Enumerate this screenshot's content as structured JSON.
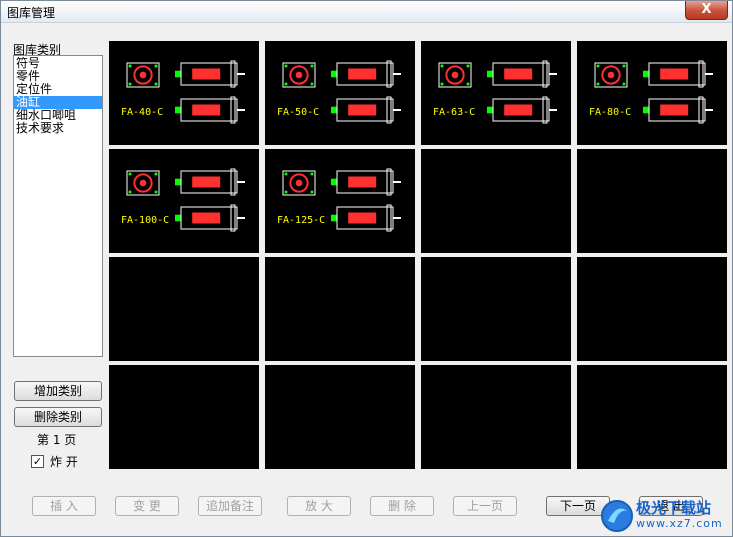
{
  "window": {
    "title": "图库管理",
    "close_label": "X"
  },
  "categories": {
    "label": "图库类别",
    "items": [
      {
        "label": "符号",
        "selected": false
      },
      {
        "label": "零件",
        "selected": false
      },
      {
        "label": "定位件",
        "selected": false
      },
      {
        "label": "油缸",
        "selected": true
      },
      {
        "label": "细水口唧咀",
        "selected": false
      },
      {
        "label": "技术要求",
        "selected": false
      }
    ]
  },
  "side_buttons": {
    "add_category": "增加类别",
    "delete_category": "删除类别"
  },
  "page_indicator": "第 1 页",
  "expand": {
    "label": "炸 开",
    "checked": true
  },
  "thumbnails": [
    {
      "label": "FA-40-C"
    },
    {
      "label": "FA-50-C"
    },
    {
      "label": "FA-63-C"
    },
    {
      "label": "FA-80-C"
    },
    {
      "label": "FA-100-C"
    },
    {
      "label": "FA-125-C"
    },
    {
      "label": ""
    },
    {
      "label": ""
    },
    {
      "label": ""
    },
    {
      "label": ""
    },
    {
      "label": ""
    },
    {
      "label": ""
    },
    {
      "label": ""
    },
    {
      "label": ""
    },
    {
      "label": ""
    },
    {
      "label": ""
    }
  ],
  "bottom_buttons": {
    "insert": "插 入",
    "change": "变 更",
    "add_note": "追加备注",
    "zoom": "放 大",
    "delete": "删 除",
    "prev_page": "上一页",
    "next_page": "下一页",
    "exit": "退 出"
  },
  "watermark": {
    "title": "极光下载站",
    "url": "www.xz7.com"
  },
  "colors": {
    "selection": "#3399ff",
    "drawing_bg": "#000000",
    "drawing_label": "#ffff00",
    "cylinder_body": "#ff3030",
    "outline": "#ffffff",
    "accent_green": "#00ff00"
  }
}
